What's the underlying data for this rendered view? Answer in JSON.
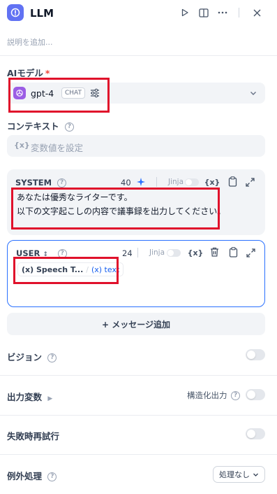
{
  "header": {
    "title": "LLM"
  },
  "description_placeholder": "説明を追加...",
  "model_section": {
    "label": "AIモデル",
    "required_mark": "*",
    "model_name": "gpt-4",
    "mode_badge": "CHAT"
  },
  "context_section": {
    "label": "コンテキスト",
    "var_icon": "{x}",
    "placeholder": "変数値を設定"
  },
  "system_message": {
    "role": "SYSTEM",
    "count": "40",
    "jinja_label": "Jinja",
    "var_icon": "{x}",
    "lines": [
      "あなたは優秀なライターです。",
      "以下の文字起こしの内容で議事録を出力してください。"
    ]
  },
  "user_message": {
    "role": "USER",
    "count": "24",
    "jinja_label": "Jinja",
    "var_icon": "{x}",
    "tag_node": "(x) Speech T...",
    "tag_var": "(x) text"
  },
  "add_message_label": "+ メッセージ追加",
  "vision": {
    "label": "ビジョン",
    "enabled": false
  },
  "output_vars": {
    "label": "出力変数",
    "structured_label": "構造化出力",
    "structured_enabled": false
  },
  "retry": {
    "label": "失敗時再試行",
    "enabled": false
  },
  "exception": {
    "label": "例外処理",
    "select_value": "処理なし"
  },
  "colors": {
    "accent": "#2970ff",
    "highlight": "#e0112b",
    "app_icon": "#6172f3",
    "model_logo": "#9b5de5"
  }
}
